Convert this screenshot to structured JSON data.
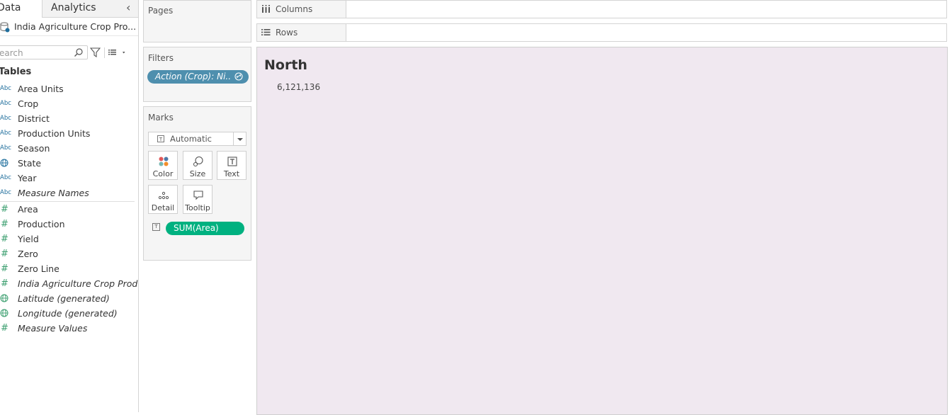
{
  "data_pane": {
    "tab_data": "Data",
    "tab_analytics": "Analytics",
    "collapse_icon": "chevron-left-icon",
    "datasource": "India Agriculture Crop Pro...",
    "search_placeholder": "earch",
    "tables_heading": "Tables",
    "dimensions": [
      {
        "type": "Abc",
        "name": "Area Units"
      },
      {
        "type": "Abc",
        "name": "Crop"
      },
      {
        "type": "Abc",
        "name": "District"
      },
      {
        "type": "Abc",
        "name": "Production Units"
      },
      {
        "type": "Abc",
        "name": "Season"
      },
      {
        "type": "globe",
        "name": "State"
      },
      {
        "type": "Abc",
        "name": "Year"
      },
      {
        "type": "Abc",
        "name": "Measure Names"
      }
    ],
    "measures": [
      {
        "type": "#",
        "name": "Area"
      },
      {
        "type": "#",
        "name": "Production"
      },
      {
        "type": "#",
        "name": "Yield"
      },
      {
        "type": "#",
        "name": "Zero"
      },
      {
        "type": "#",
        "name": "Zero Line"
      },
      {
        "type": "#",
        "name": "India Agriculture Crop Prod..."
      },
      {
        "type": "globe",
        "name": "Latitude (generated)"
      },
      {
        "type": "globe",
        "name": "Longitude (generated)"
      },
      {
        "type": "#",
        "name": "Measure Values"
      }
    ]
  },
  "pages": {
    "title": "Pages"
  },
  "filters": {
    "title": "Filters",
    "pill": "Action (Crop): Ni.."
  },
  "marks": {
    "title": "Marks",
    "mark_type": "Automatic",
    "buttons": {
      "color": "Color",
      "size": "Size",
      "text": "Text",
      "detail": "Detail",
      "tooltip": "Tooltip"
    },
    "pill": "SUM(Area)"
  },
  "shelves": {
    "columns": "Columns",
    "rows": "Rows"
  },
  "view": {
    "title": "North",
    "value": "6,121,136"
  },
  "colors": {
    "filter_pill": "#4e8fae",
    "measure_pill": "#00b180",
    "view_bg": "#f0e8f0"
  }
}
